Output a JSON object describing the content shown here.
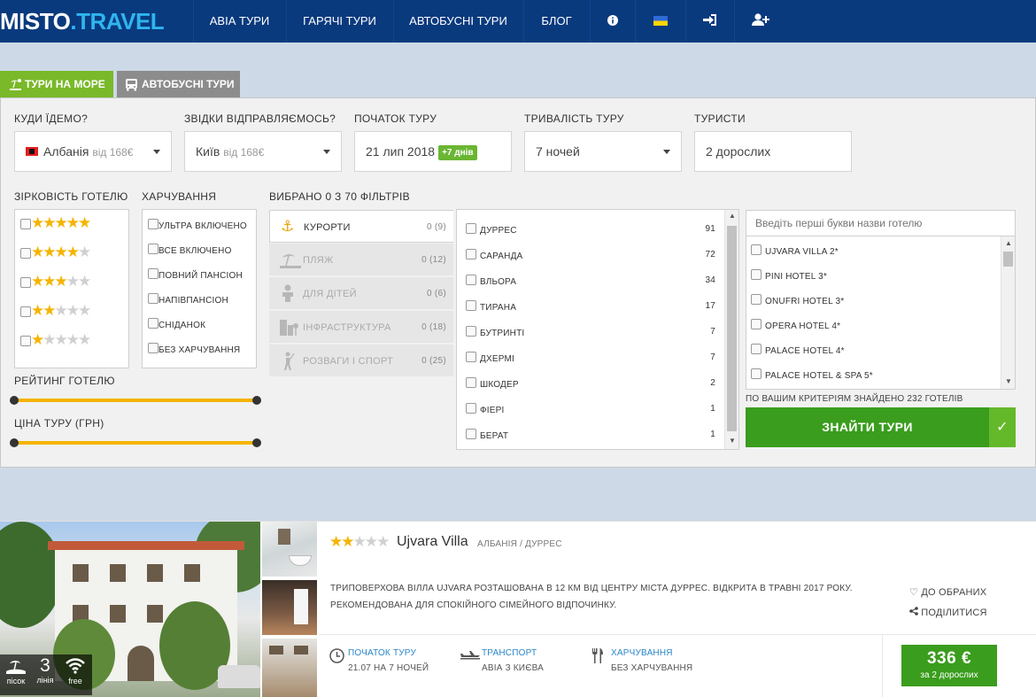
{
  "header": {
    "logo_main": "MISTO",
    "logo_dot": ".",
    "logo_tail": "TRAVEL",
    "nav": [
      "АВІА ТУРИ",
      "ГАРЯЧІ ТУРИ",
      "АВТОБУСНІ ТУРИ",
      "БЛОГ"
    ],
    "icons": [
      "info-icon",
      "ukraine-flag-icon",
      "login-icon",
      "add-user-icon"
    ]
  },
  "tabs": {
    "sea": "ТУРИ НА МОРЕ",
    "bus": "АВТОБУСНІ ТУРИ"
  },
  "search": {
    "where_label": "КУДИ ЇДЕМО?",
    "where_value": "Албанія",
    "where_price": "від 168€",
    "from_label": "ЗВІДКИ ВІДПРАВЛЯЄМОСЬ?",
    "from_value": "Київ",
    "from_price": "від 168€",
    "start_label": "ПОЧАТОК ТУРУ",
    "start_value": "21 лип 2018",
    "start_badge": "+7 днів",
    "duration_label": "ТРИВАЛІСТЬ ТУРУ",
    "duration_value": "7 ночей",
    "tourists_label": "ТУРИСТИ",
    "tourists_value": "2 дорослих"
  },
  "filters": {
    "stars_label": "ЗІРКОВІСТЬ ГОТЕЛЮ",
    "star_levels": [
      5,
      4,
      3,
      2,
      1
    ],
    "food_label": "ХАРЧУВАННЯ",
    "food": [
      "УЛЬТРА ВКЛЮЧЕНО",
      "ВСЕ ВКЛЮЧЕНО",
      "ПОВНИЙ ПАНСІОН",
      "НАПІВПАНСІОН",
      "СНІДАНОК",
      "БЕЗ ХАРЧУВАННЯ"
    ],
    "rating_label": "РЕЙТИНГ ГОТЕЛЮ",
    "price_label": "ЦІНА ТУРУ (ГРН)",
    "selected_label": "ВИБРАНО 0 З 70 ФІЛЬТРІВ",
    "categories": [
      {
        "name": "КУРОРТИ",
        "count": "0 (9)"
      },
      {
        "name": "ПЛЯЖ",
        "count": "0 (12)"
      },
      {
        "name": "ДЛЯ ДІТЕЙ",
        "count": "0 (6)"
      },
      {
        "name": "ІНФРАСТРУКТУРА",
        "count": "0 (18)"
      },
      {
        "name": "РОЗВАГИ І СПОРТ",
        "count": "0 (25)"
      }
    ],
    "resorts": [
      {
        "name": "ДУРРЕС",
        "count": "91"
      },
      {
        "name": "САРАНДА",
        "count": "72"
      },
      {
        "name": "ВЛЬОРА",
        "count": "34"
      },
      {
        "name": "ТИРАНА",
        "count": "17"
      },
      {
        "name": "БУТРИНТІ",
        "count": "7"
      },
      {
        "name": "ДХЕРМІ",
        "count": "7"
      },
      {
        "name": "ШКОДЕР",
        "count": "2"
      },
      {
        "name": "ФІЕРІ",
        "count": "1"
      },
      {
        "name": "БЕРАТ",
        "count": "1"
      }
    ],
    "hotel_search_placeholder": "Введіть перші букви назви готелю",
    "hotels": [
      "UJVARA VILLA 2*",
      "PINI HOTEL 3*",
      "ONUFRI HOTEL 3*",
      "OPERA HOTEL 4*",
      "PALACE HOTEL 4*",
      "PALACE HOTEL & SPA 5*"
    ],
    "found_text": "ПО ВАШИМ КРИТЕРІЯМ ЗНАЙДЕНО 232 ГОТЕЛІВ",
    "find_button": "ЗНАЙТИ ТУРИ",
    "find_check": "✓"
  },
  "card": {
    "stars": 2,
    "name": "Ujvara Villa",
    "location": "АЛБАНІЯ / ДУРРЕС",
    "description": "ТРИПОВЕРХОВА ВІЛЛА UJVARA РОЗТАШОВАНА В 12 КМ ВІД ЦЕНТРУ МІСТА ДУРРЕС. ВІДКРИТА В ТРАВНІ 2017 РОКУ. РЕКОМЕНДОВАНА ДЛЯ СПОКІЙНОГО СІМЕЙНОГО ВІДПОЧИНКУ.",
    "favorite": "ДО ОБРАНИХ",
    "share": "ПОДІЛИТИСЯ",
    "badge_beach": "пісок",
    "badge_line_num": "3",
    "badge_line": "лінія",
    "badge_wifi": "free",
    "start_label": "ПОЧАТОК ТУРУ",
    "start_value": "21.07 НА 7 НОЧЕЙ",
    "transport_label": "ТРАНСПОРТ",
    "transport_value": "АВІА З КИЄВА",
    "food_label": "ХАРЧУВАННЯ",
    "food_value": "БЕЗ ХАРЧУВАННЯ",
    "price": "336 €",
    "price_per": "за 2 дорослих"
  },
  "colors": {
    "nav_bg": "#0a3a7e",
    "accent_green": "#3a9d1d",
    "tab_green": "#7ab929",
    "star": "#f4b400",
    "link_blue": "#2a86c9"
  }
}
